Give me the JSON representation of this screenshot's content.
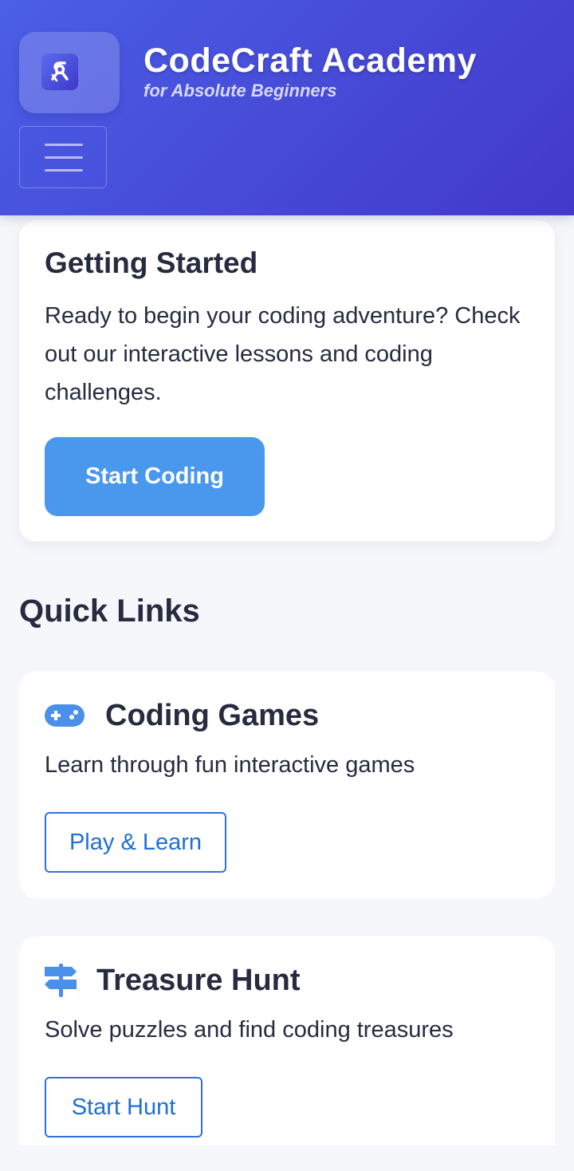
{
  "header": {
    "title": "CodeCraft Academy",
    "subtitle": "for Absolute Beginners",
    "logo_icon": "code-logo-icon",
    "menu_icon": "hamburger-menu-icon"
  },
  "getting_started": {
    "title": "Getting Started",
    "text": "Ready to begin your coding adventure? Check out our interactive lessons and coding challenges.",
    "button_label": "Start Coding"
  },
  "quick_links": {
    "title": "Quick Links",
    "items": [
      {
        "icon": "gamepad-icon",
        "title": "Coding Games",
        "description": "Learn through fun interactive games",
        "button_label": "Play & Learn"
      },
      {
        "icon": "signpost-icon",
        "title": "Treasure Hunt",
        "description": "Solve puzzles and find coding treasures",
        "button_label": "Start Hunt"
      }
    ]
  },
  "colors": {
    "header_gradient_start": "#4a5fe6",
    "header_gradient_end": "#4338ca",
    "primary_button": "#4a97ee",
    "outline_button": "#2f72d8",
    "icon_blue": "#4a8fe8",
    "text_dark": "#262b3f",
    "background": "#f5f7fb"
  }
}
